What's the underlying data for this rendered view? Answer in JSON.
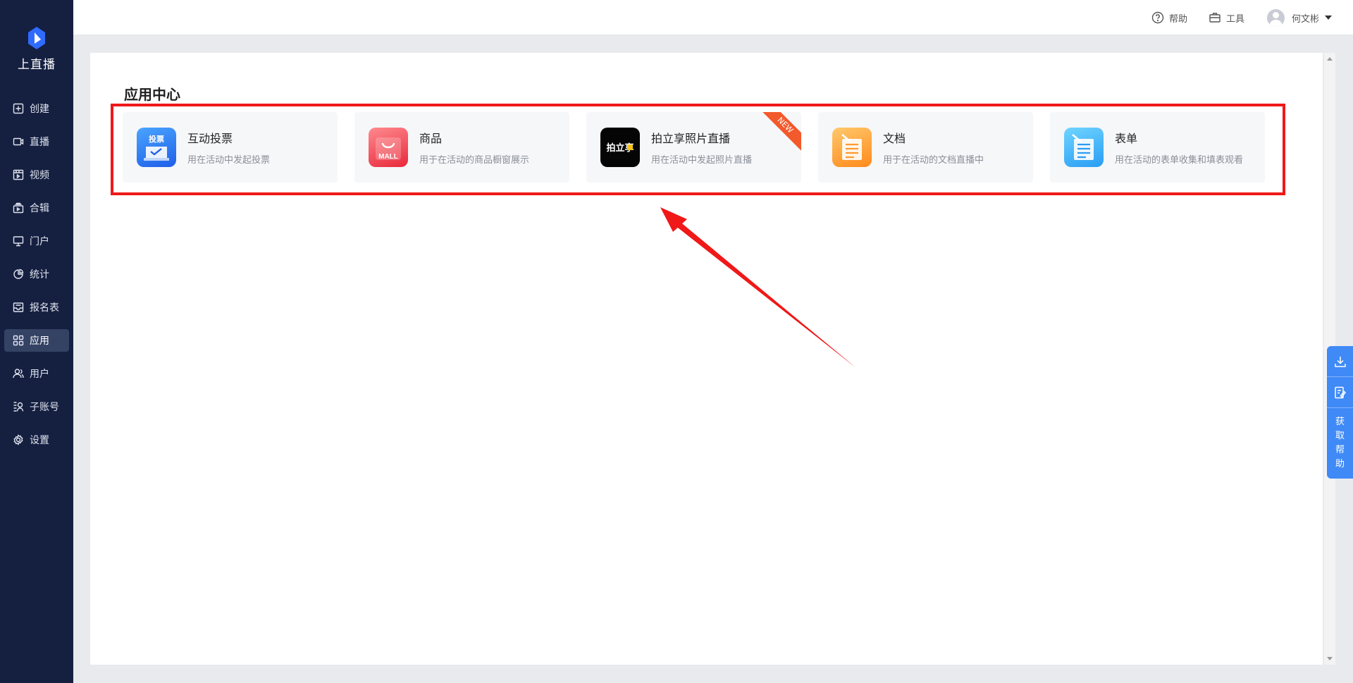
{
  "app": {
    "brand": "上直播",
    "brand_color": "#2f6bff"
  },
  "sidebar": {
    "items": [
      {
        "label": "创建",
        "icon": "plus-square-icon"
      },
      {
        "label": "直播",
        "icon": "camera-icon"
      },
      {
        "label": "视频",
        "icon": "film-icon"
      },
      {
        "label": "合辑",
        "icon": "collection-icon"
      },
      {
        "label": "门户",
        "icon": "monitor-icon"
      },
      {
        "label": "统计",
        "icon": "pie-chart-icon"
      },
      {
        "label": "报名表",
        "icon": "inbox-icon"
      },
      {
        "label": "应用",
        "icon": "grid-icon",
        "active": true
      },
      {
        "label": "用户",
        "icon": "users-icon"
      },
      {
        "label": "子账号",
        "icon": "sub-account-icon"
      },
      {
        "label": "设置",
        "icon": "gear-icon"
      }
    ]
  },
  "header": {
    "help_label": "帮助",
    "tools_label": "工具",
    "user_name": "何文彬"
  },
  "main": {
    "section_title": "应用中心",
    "apps": [
      {
        "name": "互动投票",
        "desc": "用在活动中发起投票",
        "icon_text": "投票"
      },
      {
        "name": "商品",
        "desc": "用于在活动的商品橱窗展示",
        "icon_text": "MALL"
      },
      {
        "name": "拍立享照片直播",
        "desc": "用在活动中发起照片直播",
        "icon_text": "拍立享",
        "badge": "NEW"
      },
      {
        "name": "文档",
        "desc": "用于在活动的文档直播中",
        "icon_text": ""
      },
      {
        "name": "表单",
        "desc": "用在活动的表单收集和填表观看",
        "icon_text": ""
      }
    ]
  },
  "float": {
    "help_chars": [
      "获",
      "取",
      "帮",
      "助"
    ]
  },
  "colors": {
    "sidebar_bg": "#152041",
    "active_item_bg": "#344264",
    "annotation_red": "#f01818",
    "float_blue": "#3f8af7"
  }
}
